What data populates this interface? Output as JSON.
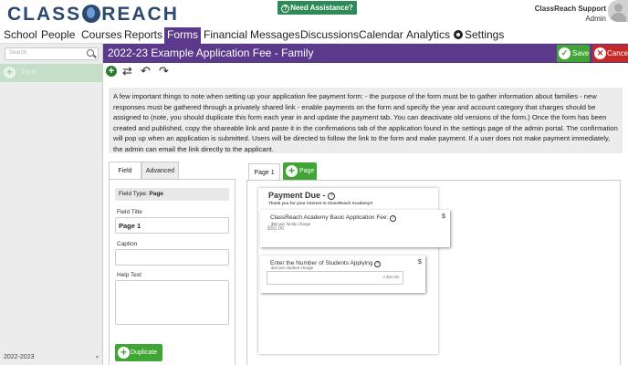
{
  "header": {
    "logo": "CLASS REACH",
    "assistance_label": "Need Assistance?",
    "user_name": "ClassReach Support",
    "user_role": "Admin"
  },
  "nav": {
    "items": [
      "School",
      "People",
      "Courses",
      "Reports",
      "Forms",
      "Financial",
      "Messages",
      "Discussions",
      "Calendar",
      "Analytics",
      "Settings"
    ],
    "active": "Forms"
  },
  "sidebar": {
    "search_placeholder": "Search",
    "form_item_label": "Form",
    "year_selector": "2022-2023"
  },
  "titlebar": {
    "title": "2022-23 Example Application Fee - Family",
    "save_label": "Save",
    "cancel_label": "Cancel"
  },
  "toolbar": {
    "icons": [
      "add-icon",
      "shuffle-icon",
      "undo-icon",
      "redo-icon"
    ]
  },
  "info_text": "A few important things to note when setting up your application fee payment form: - the purpose of the form must be to gather information about families - new responses must be gathered through a privately shared link - enable payments on the form and specify the year and account category that charges should be assigned to (note, you should duplicate this form each year in and update the payment tab. You can deactivate old versions of the form.) Once the form has been created and published, copy the shareable link and paste it in the confirmations tab of the application found in the settings page of the admin portal. The confirmation will pop up when an application is submitted. Users will be directed to follow the link to the form and make payment. If a user does not make payment immediately, the admin can email the link directly to the applicant.",
  "field_panel": {
    "tabs": [
      "Field",
      "Advanced"
    ],
    "field_type_label": "Field Type:",
    "field_type_value": "Page",
    "field_title_label": "Field Title",
    "field_title_value": "Page 1",
    "caption_label": "Caption",
    "help_text_label": "Help Text",
    "duplicate_label": "Duplicate"
  },
  "page_area": {
    "page_tab": "Page 1",
    "add_page_label": "Page",
    "payment_title": "Payment Due -",
    "payment_subtitle": "Thank you for your interest in ClassReach Academy!!",
    "item1_label": "ClassReach Academy Basic Application Fee:",
    "item1_sub": "$50 per family charge",
    "item1_amount": "$50.00",
    "item1_currency": "$",
    "item2_label": "Enter the Number of Students Applying",
    "item2_sub": "$10 per student charge",
    "item2_multiplier": "x $10.00",
    "item2_currency": "$"
  },
  "colors": {
    "brand_purple": "#5b3a8c",
    "green": "#41a535",
    "red": "#c62828",
    "logo_blue": "#2a4870"
  }
}
